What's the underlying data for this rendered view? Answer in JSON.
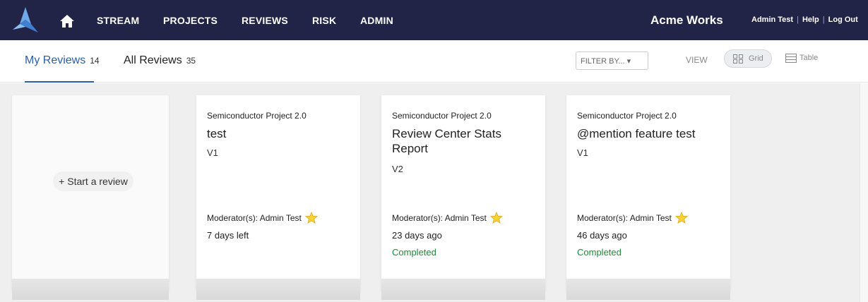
{
  "nav": {
    "items": [
      "STREAM",
      "PROJECTS",
      "REVIEWS",
      "RISK",
      "ADMIN"
    ],
    "brand": "Acme Works",
    "user": "Admin Test",
    "help": "Help",
    "logout": "Log Out",
    "separator": "|",
    "bg_color": "#212447"
  },
  "tabs": {
    "mine_label": "My Reviews",
    "mine_count": "14",
    "all_label": "All Reviews",
    "all_count": "35",
    "active_color": "#2d5eaa"
  },
  "toolbar": {
    "filter_label": "FILTER BY... ▾",
    "view_label": "VIEW",
    "grid_label": "Grid",
    "table_label": "Table"
  },
  "start_card": {
    "label": "+ Start a review"
  },
  "reviews": [
    {
      "project": "Semiconductor Project 2.0",
      "title": "test",
      "version": "V1",
      "moderator": "Moderator(s): Admin Test",
      "time": "7 days left",
      "status": ""
    },
    {
      "project": "Semiconductor Project 2.0",
      "title": "Review Center Stats Report",
      "version": "V2",
      "moderator": "Moderator(s): Admin Test",
      "time": "23 days ago",
      "status": "Completed"
    },
    {
      "project": "Semiconductor Project 2.0",
      "title": "@mention feature test",
      "version": "V1",
      "moderator": "Moderator(s): Admin Test",
      "time": "46 days ago",
      "status": "Completed"
    }
  ],
  "icons": {
    "logo": "logo-icon",
    "home": "home-icon",
    "grid": "grid-icon",
    "table": "table-icon",
    "star": "star-icon"
  },
  "status_color": "#1e8a3c"
}
